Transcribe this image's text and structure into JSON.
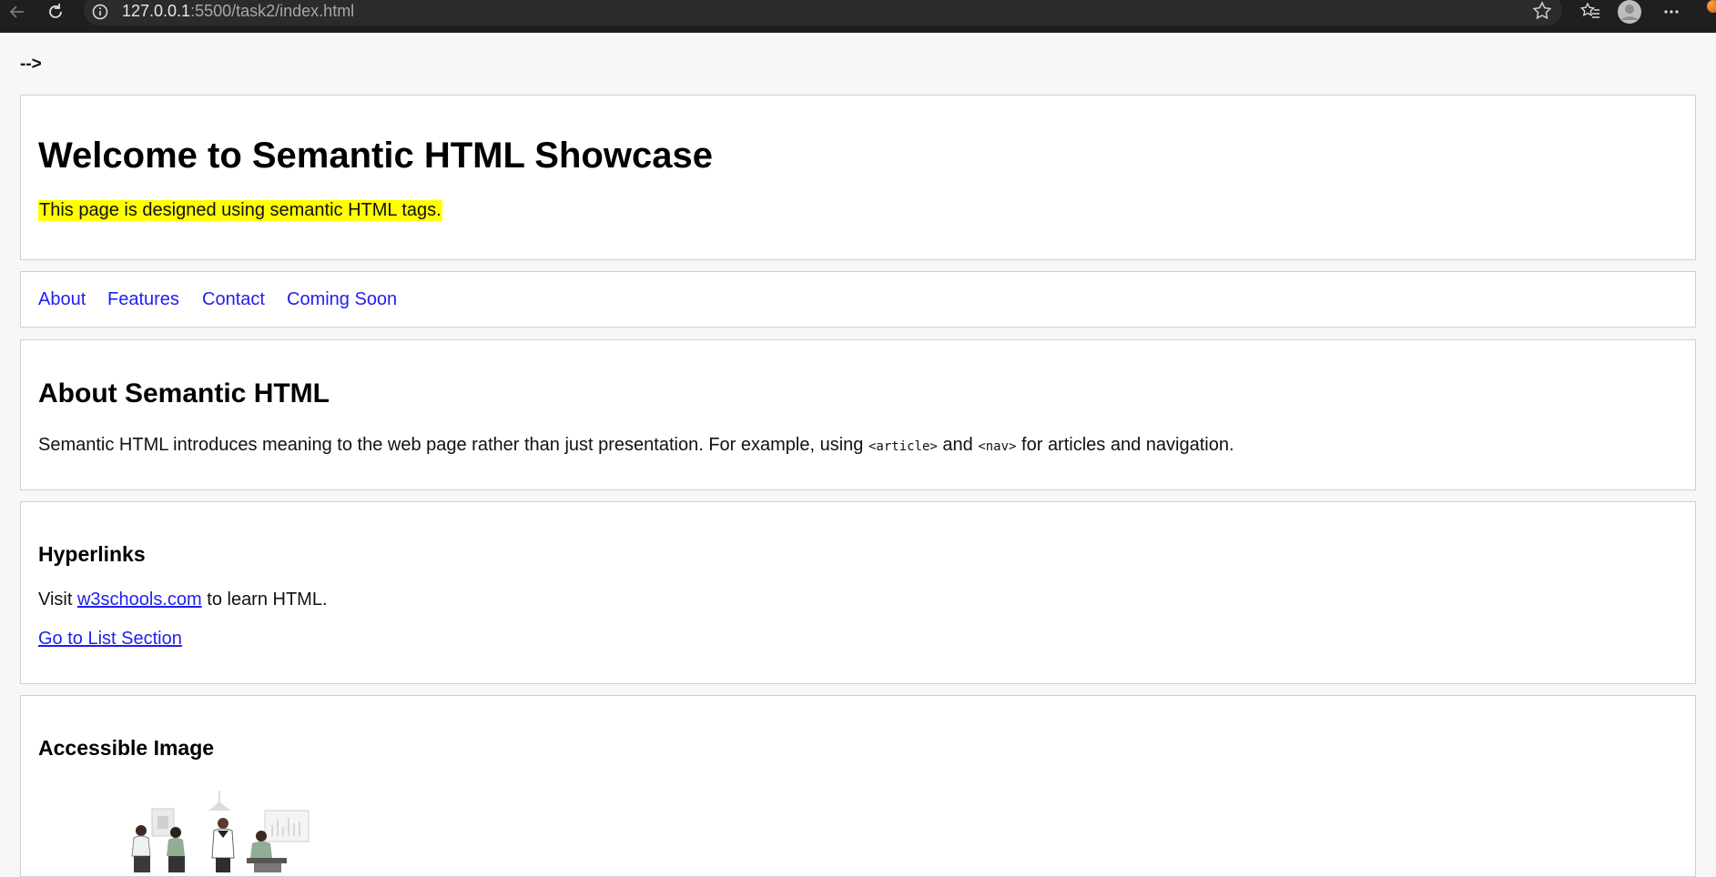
{
  "browser": {
    "url_host": "127.0.0.1",
    "url_path": ":5500/task2/index.html",
    "icons": [
      "back-icon",
      "reload-icon",
      "info-icon",
      "star-icon",
      "favorites-icon",
      "profile-avatar",
      "more-icon"
    ]
  },
  "page": {
    "stray_text": "-->",
    "header": {
      "title": "Welcome to Semantic HTML Showcase",
      "tagline": "This page is designed using semantic HTML tags.",
      "tagline_bg": "#ffff00"
    },
    "nav": {
      "items": [
        {
          "label": "About"
        },
        {
          "label": "Features"
        },
        {
          "label": "Contact"
        },
        {
          "label": "Coming Soon"
        }
      ],
      "link_color": "#1f1ff0"
    },
    "about": {
      "heading": "About Semantic HTML",
      "text_before": "Semantic HTML introduces meaning to the web page rather than just presentation. For example, using ",
      "code1": "<article>",
      "text_middle": " and ",
      "code2": "<nav>",
      "text_after": " for articles and navigation."
    },
    "hyperlinks": {
      "heading": "Hyperlinks",
      "visit_prefix": "Visit ",
      "link_text": "w3schools.com",
      "visit_suffix": " to learn HTML.",
      "anchor_link": "Go to List Section"
    },
    "image_section": {
      "heading": "Accessible Image",
      "image": "team-meeting-illustration"
    }
  }
}
